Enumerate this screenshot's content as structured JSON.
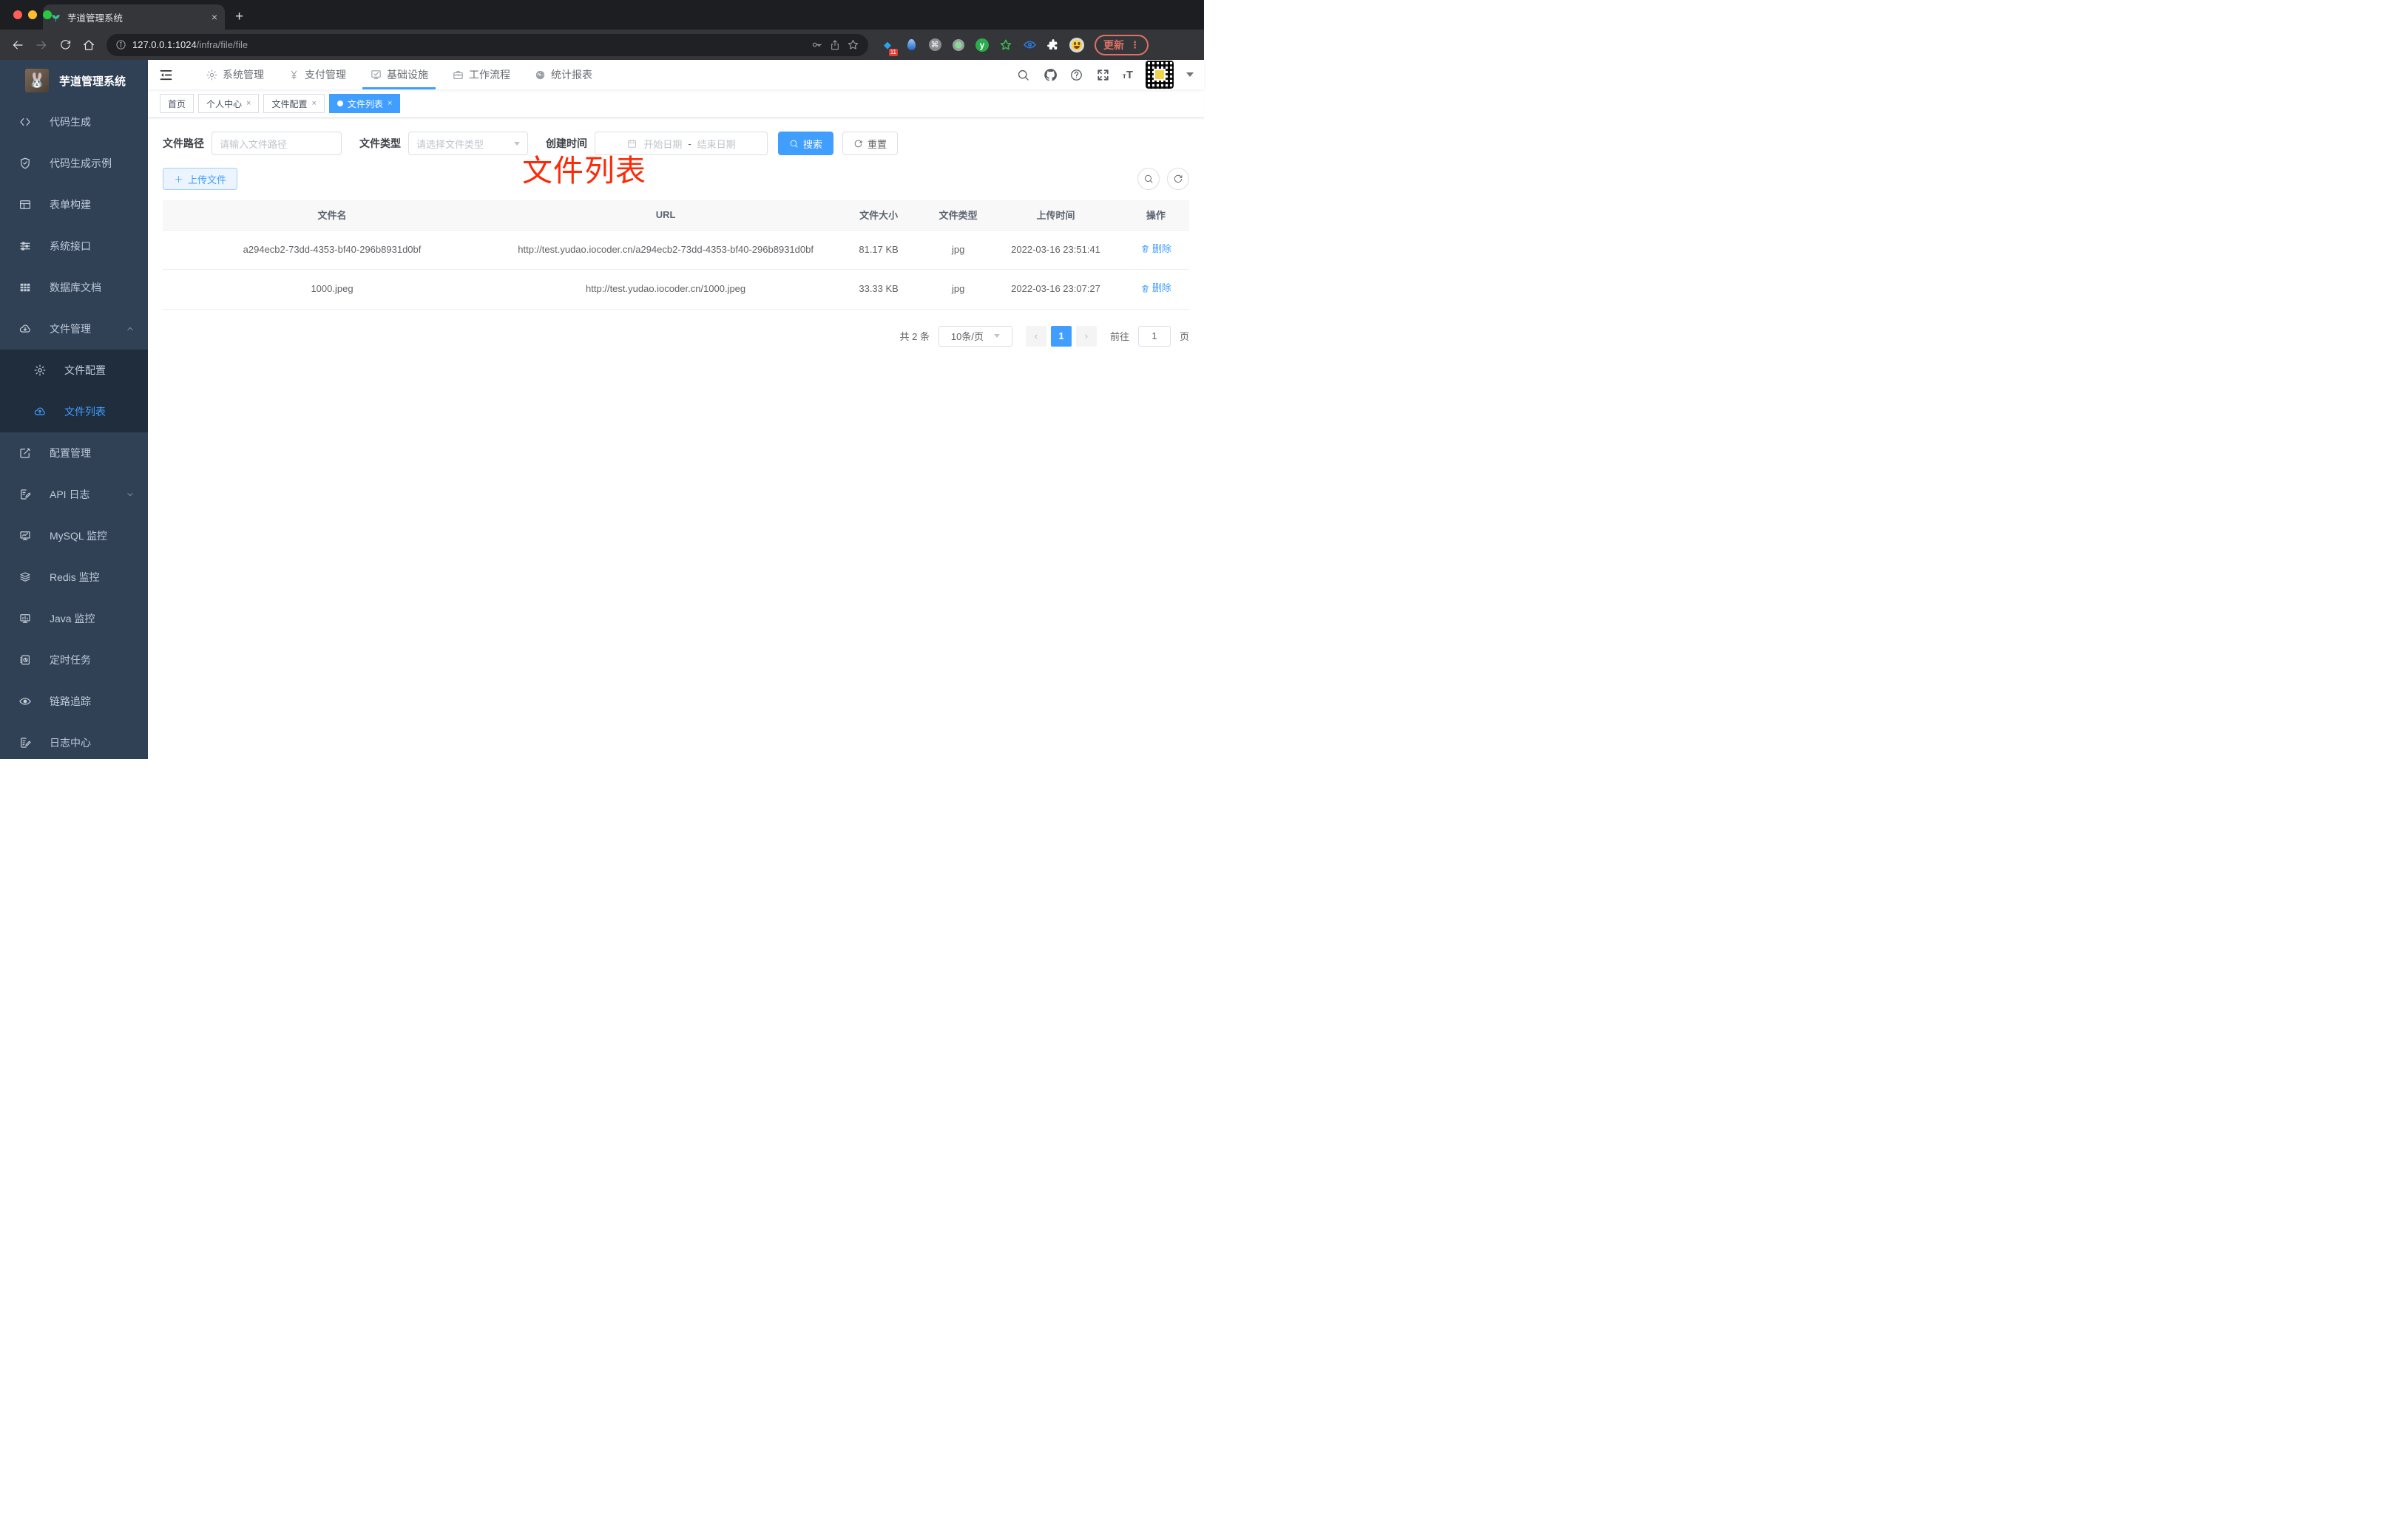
{
  "colors": {
    "accent": "#409eff",
    "sidebar_bg": "#304156",
    "submenu_bg": "#1f2d3d",
    "annotation_red": "#fb2a08",
    "traffic": [
      "#ff5f57",
      "#febc2e",
      "#28c840"
    ]
  },
  "browser": {
    "tab_title": "芋道管理系统",
    "favicon": "sprout-icon",
    "new_tab_glyph": "+",
    "close_glyph": "×",
    "url_host": "127.0.0.1:1024",
    "url_path": "/infra/file/file",
    "extension_badge": "11",
    "extension_icons": [
      "pin-extension-icon",
      "balloon-extension-icon",
      "command-extension-icon",
      "record-extension-icon",
      "yuque-extension-icon",
      "green-star-extension-icon",
      "blue-eye-extension-icon",
      "puzzle-extension-icon",
      "emoji-extension-icon"
    ],
    "update_label": "更新",
    "menu_dots": "⋮"
  },
  "app": {
    "title": "芋道管理系统",
    "top_menu": [
      {
        "label": "系统管理",
        "icon": "gear-icon",
        "active": false
      },
      {
        "label": "支付管理",
        "icon": "yen-icon",
        "active": false
      },
      {
        "label": "基础设施",
        "icon": "infra-monitor-icon",
        "active": true
      },
      {
        "label": "工作流程",
        "icon": "briefcase-icon",
        "active": false
      },
      {
        "label": "统计报表",
        "icon": "report-gauge-icon",
        "active": false
      }
    ],
    "sidebar": [
      {
        "label": "代码生成",
        "icon": "code-icon"
      },
      {
        "label": "代码生成示例",
        "icon": "shield-check-icon"
      },
      {
        "label": "表单构建",
        "icon": "form-builder-icon"
      },
      {
        "label": "系统接口",
        "icon": "sliders-icon"
      },
      {
        "label": "数据库文档",
        "icon": "database-table-icon"
      },
      {
        "label": "文件管理",
        "icon": "cloud-download-icon",
        "arrow": "up",
        "children": [
          {
            "label": "文件配置",
            "icon": "gear-icon",
            "active": false
          },
          {
            "label": "文件列表",
            "icon": "cloud-upload-icon",
            "active": true
          }
        ]
      },
      {
        "label": "配置管理",
        "icon": "edit-square-icon"
      },
      {
        "label": "API 日志",
        "icon": "doc-edit-icon",
        "arrow": "down"
      },
      {
        "label": "MySQL 监控",
        "icon": "mysql-monitor-icon"
      },
      {
        "label": "Redis 监控",
        "icon": "redis-layers-icon"
      },
      {
        "label": "Java 监控",
        "icon": "java-monitor-icon"
      },
      {
        "label": "定时任务",
        "icon": "timer-icon"
      },
      {
        "label": "链路追踪",
        "icon": "eye-icon"
      },
      {
        "label": "日志中心",
        "icon": "log-center-icon"
      }
    ],
    "page_tabs": [
      {
        "label": "首页",
        "closable": false,
        "active": false
      },
      {
        "label": "个人中心",
        "closable": true,
        "active": false
      },
      {
        "label": "文件配置",
        "closable": true,
        "active": false
      },
      {
        "label": "文件列表",
        "closable": true,
        "active": true
      }
    ],
    "annotation": "文件列表",
    "filters": {
      "path_label": "文件路径",
      "path_placeholder": "请输入文件路径",
      "type_label": "文件类型",
      "type_placeholder": "请选择文件类型",
      "time_label": "创建时间",
      "start_placeholder": "开始日期",
      "range_separator": "-",
      "end_placeholder": "结束日期",
      "search_label": "搜索",
      "reset_label": "重置"
    },
    "toolbar": {
      "upload_label": "上传文件"
    },
    "table": {
      "headers": [
        "文件名",
        "URL",
        "文件大小",
        "文件类型",
        "上传时间",
        "操作"
      ],
      "rows": [
        {
          "name": "a294ecb2-73dd-4353-bf40-296b8931d0bf",
          "url": "http://test.yudao.iocoder.cn/a294ecb2-73dd-4353-bf40-296b8931d0bf",
          "size": "81.17 KB",
          "type": "jpg",
          "time": "2022-03-16 23:51:41",
          "action": "删除"
        },
        {
          "name": "1000.jpeg",
          "url": "http://test.yudao.iocoder.cn/1000.jpeg",
          "size": "33.33 KB",
          "type": "jpg",
          "time": "2022-03-16 23:07:27",
          "action": "删除"
        }
      ]
    },
    "pagination": {
      "total": "共 2 条",
      "page_size": "10条/页",
      "prev_glyph": "‹",
      "next_glyph": "›",
      "current_page": "1",
      "goto_prefix": "前往",
      "goto_value": "1",
      "goto_suffix": "页"
    }
  }
}
